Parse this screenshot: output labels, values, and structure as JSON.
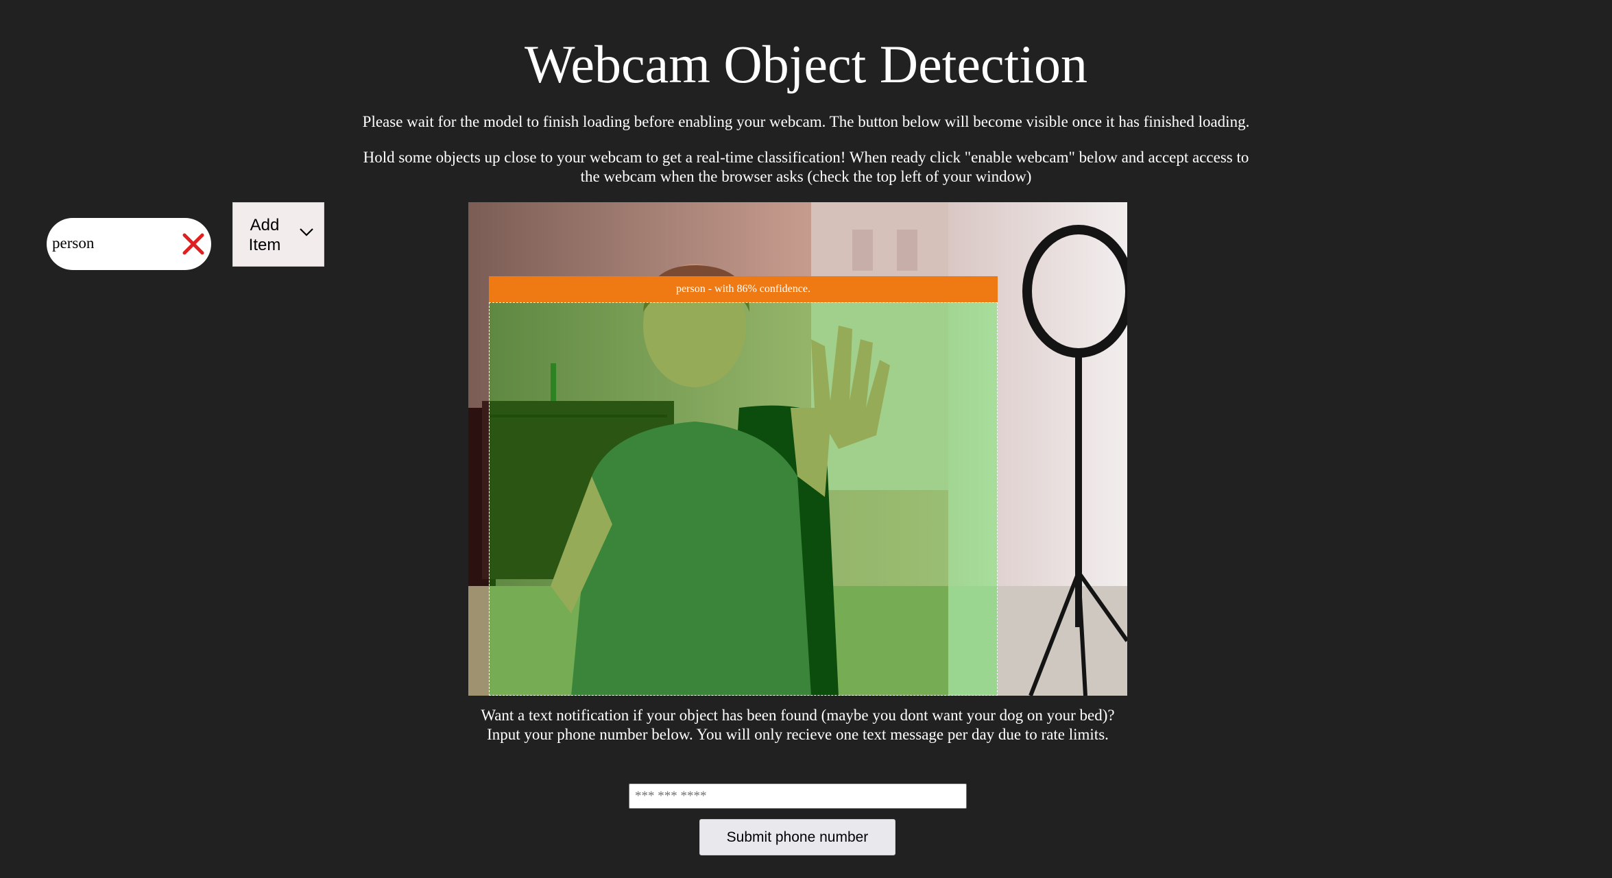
{
  "page": {
    "title": "Webcam Object Detection",
    "intro_loading": "Please wait for the model to finish loading before enabling your webcam. The button below will become visible once it has finished loading.",
    "intro_instructions": "Hold some objects up close to your webcam to get a real-time classification! When ready click \"enable webcam\" below and accept access to the webcam when the browser asks (check the top left of your window)"
  },
  "filter": {
    "chip_label": "person",
    "clear_icon": "close-icon",
    "add_button_label": "Add Item",
    "add_button_icon": "chevron-down-icon"
  },
  "detection": {
    "label": "person - with 86% confidence.",
    "label_color": "#ef7a14",
    "highlight_color": "#00ff00"
  },
  "notification": {
    "text": "Want a text notification if your object has been found (maybe you dont want your dog on your bed)? Input your phone number below. You will only recieve one text message per day due to rate limits.",
    "phone_placeholder": "*** *** ****",
    "submit_label": "Submit phone number"
  },
  "colors": {
    "background": "#212121",
    "text": "#ffffff",
    "clear_icon": "#e02020"
  }
}
